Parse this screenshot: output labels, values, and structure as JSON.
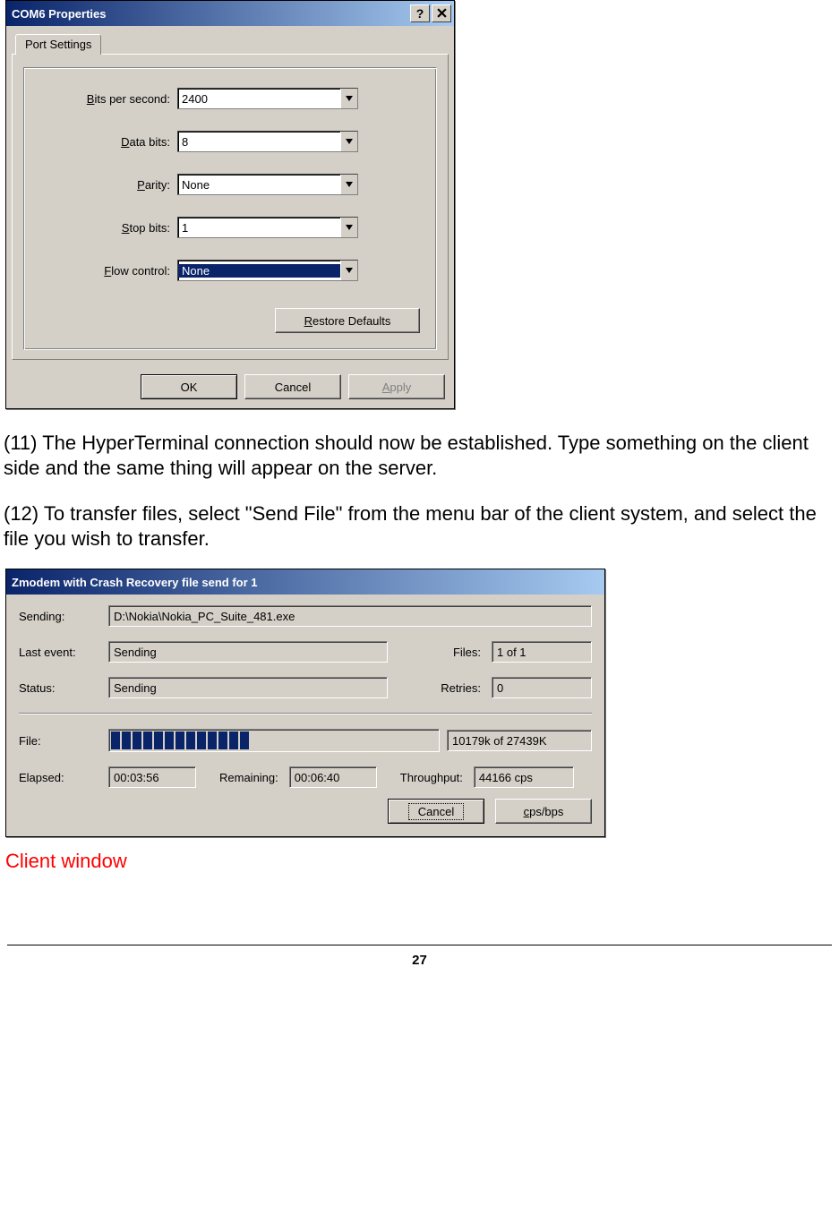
{
  "com6": {
    "title": "COM6 Properties",
    "tab": "Port Settings",
    "fields": {
      "bits_per_second": {
        "label_pre": "B",
        "label_post": "its per second:",
        "value": "2400"
      },
      "data_bits": {
        "label_pre": "D",
        "label_post": "ata bits:",
        "value": "8"
      },
      "parity": {
        "label_pre": "P",
        "label_post": "arity:",
        "value": "None"
      },
      "stop_bits": {
        "label_pre": "S",
        "label_post": "top bits:",
        "value": "1"
      },
      "flow_control": {
        "label_pre": "F",
        "label_post": "low control:",
        "value": "None"
      }
    },
    "restore_pre": "R",
    "restore_post": "estore Defaults",
    "ok": "OK",
    "cancel": "Cancel",
    "apply_pre": "A",
    "apply_post": "pply"
  },
  "text": {
    "p11": "(11) The HyperTerminal connection should now be established. Type something on the client side and the same thing will appear on the server.",
    "p12": "(12) To transfer files, select \"Send File\" from the menu bar of the client system, and select the file you wish to transfer.",
    "client_window": "Client window"
  },
  "zmodem": {
    "title": "Zmodem with Crash Recovery file send for 1",
    "labels": {
      "sending": "Sending:",
      "last_event": "Last event:",
      "files": "Files:",
      "status": "Status:",
      "retries": "Retries:",
      "file": "File:",
      "elapsed": "Elapsed:",
      "remaining": "Remaining:",
      "throughput": "Throughput:"
    },
    "values": {
      "sending": "D:\\Nokia\\Nokia_PC_Suite_481.exe",
      "last_event": "Sending",
      "files": "1 of 1",
      "status": "Sending",
      "retries": "0",
      "file_progress_text": "10179k of 27439K",
      "elapsed": "00:03:56",
      "remaining": "00:06:40",
      "throughput": "44166 cps"
    },
    "progress_segments": 13,
    "cancel": "Cancel",
    "cpsbps_pre": "c",
    "cpsbps_post": "ps/bps"
  },
  "page_number": "27"
}
